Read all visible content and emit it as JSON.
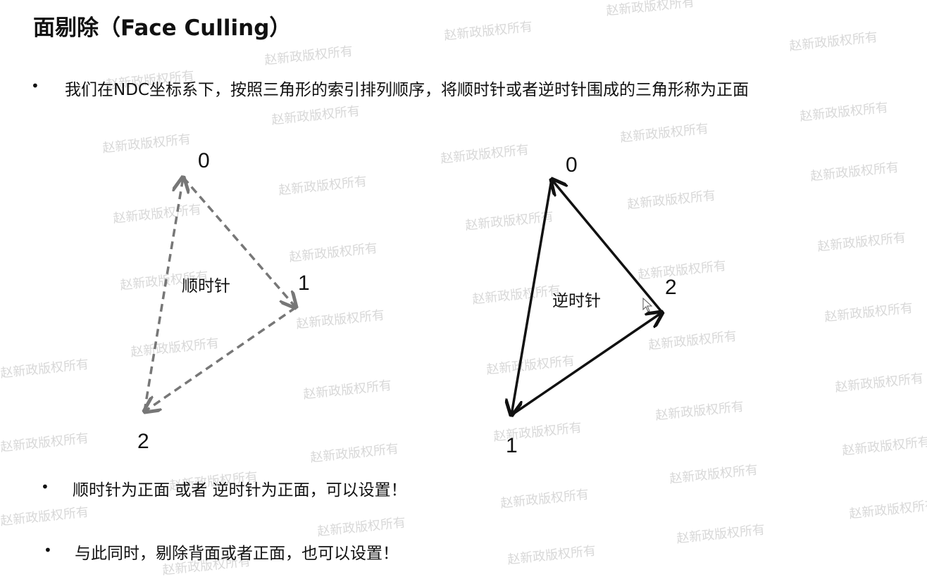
{
  "slide": {
    "title": "面剔除（Face Culling）",
    "bullets": [
      "我们在NDC坐标系下，按照三角形的索引排列顺序，将顺时针或者逆时针围成的三角形称为正面",
      "顺时针为正面  或者 逆时针为正面，可以设置！",
      "与此同时，剔除背面或者正面，也可以设置！"
    ],
    "bullet_marker": "•"
  },
  "diagram": {
    "left_triangle": {
      "label": "顺时针",
      "vertices": [
        "0",
        "1",
        "2"
      ],
      "style": "dashed",
      "color": "#777777"
    },
    "right_triangle": {
      "label": "逆时针",
      "vertices": [
        "0",
        "1",
        "2"
      ],
      "style": "solid",
      "color": "#111111"
    }
  },
  "watermark": {
    "text": "赵新政版权所有",
    "color": "#d8d8d8"
  }
}
